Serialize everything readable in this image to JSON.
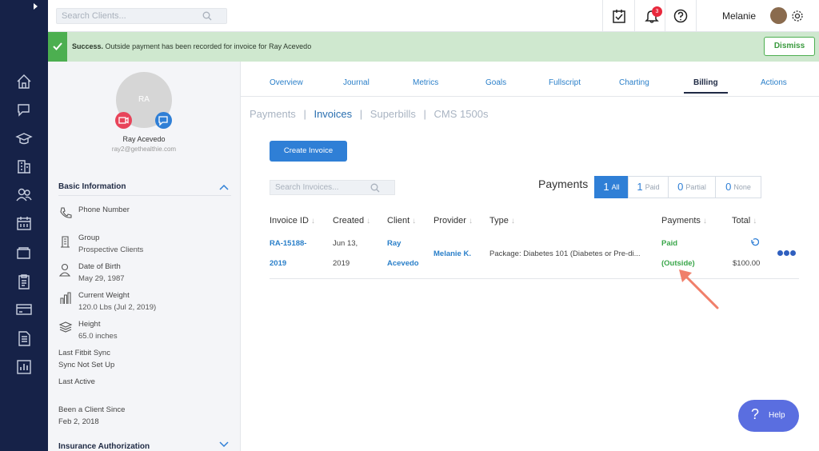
{
  "nav": {
    "icons": [
      "home-icon",
      "chat-icon",
      "education-icon",
      "building-icon",
      "users-icon",
      "calendar-icon",
      "folder-icon",
      "clipboard-icon",
      "card-icon",
      "document-icon",
      "report-icon"
    ]
  },
  "topbar": {
    "search_placeholder": "Search Clients...",
    "notification_count": "3",
    "username": "Melanie"
  },
  "banner": {
    "strong": "Success.",
    "message": "Outside payment has been recorded for invoice for Ray Acevedo",
    "dismiss": "Dismiss"
  },
  "client": {
    "initials": "RA",
    "name": "Ray Acevedo",
    "email": "ray2@gethealthie.com",
    "basic_info_title": "Basic Information",
    "phone_label": "Phone Number",
    "group_label": "Group",
    "group_value": "Prospective Clients",
    "dob_label": "Date of Birth",
    "dob_value": "May 29, 1987",
    "weight_label": "Current Weight",
    "weight_value": "120.0 Lbs (Jul 2, 2019)",
    "height_label": "Height",
    "height_value": "65.0 inches",
    "fitbit_label": "Last Fitbit Sync",
    "fitbit_value": "Sync Not Set Up",
    "last_active_label": "Last Active",
    "client_since_label": "Been a Client Since",
    "client_since_value": "Feb 2, 2018",
    "insurance_title": "Insurance Authorization"
  },
  "tabs": [
    "Overview",
    "Journal",
    "Metrics",
    "Goals",
    "Fullscript",
    "Charting",
    "Billing",
    "Actions"
  ],
  "active_tab": "Billing",
  "subtabs": {
    "payments": "Payments",
    "invoices": "Invoices",
    "superbills": "Superbills",
    "cms": "CMS 1500s",
    "sep": "|"
  },
  "create_invoice": "Create Invoice",
  "search_invoices_placeholder": "Search Invoices...",
  "payments_filter": {
    "label": "Payments",
    "options": [
      {
        "count": "1",
        "label": "All"
      },
      {
        "count": "1",
        "label": "Paid"
      },
      {
        "count": "0",
        "label": "Partial"
      },
      {
        "count": "0",
        "label": "None"
      }
    ],
    "selected": "All"
  },
  "table": {
    "headers": [
      "Invoice ID",
      "Created",
      "Client",
      "Provider",
      "Type",
      "Payments",
      "Total"
    ],
    "rows": [
      {
        "invoice_id_1": "RA-15188-",
        "invoice_id_2": "2019",
        "created_1": "Jun 13,",
        "created_2": "2019",
        "client_1": "Ray",
        "client_2": "Acevedo",
        "provider": "Melanie K.",
        "type": "Package: Diabetes 101 (Diabetes or Pre-di...",
        "payment_1": "Paid",
        "payment_2": "(Outside)",
        "total": "$100.00"
      }
    ]
  },
  "help": {
    "label": "Help"
  },
  "colors": {
    "rail": "#162248",
    "accent": "#2f7fd6",
    "success": "#4caf50",
    "annotation": "#f07f6a"
  }
}
